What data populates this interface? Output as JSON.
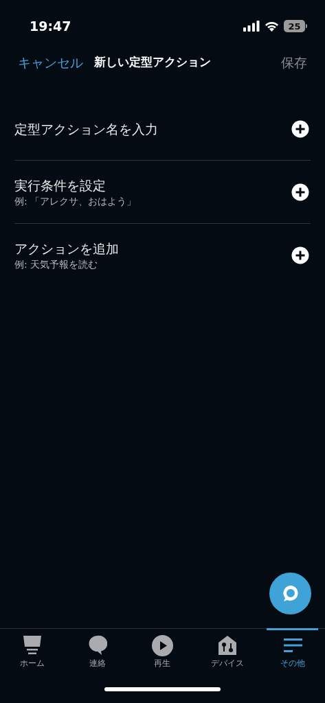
{
  "status_bar": {
    "time": "19:47",
    "battery": "25"
  },
  "nav": {
    "cancel": "キャンセル",
    "title": "新しい定型アクション",
    "save": {
      "label": "保存",
      "disabled": true
    }
  },
  "rows": [
    {
      "title": "定型アクション名を入力"
    },
    {
      "title": "実行条件を設定",
      "subtitle": "例: 「アレクサ、おはよう」"
    },
    {
      "title": "アクションを追加",
      "subtitle": "例: 天気予報を読む"
    }
  ],
  "tabs": [
    {
      "kind": "home",
      "label": "ホーム",
      "selected": false
    },
    {
      "kind": "chat",
      "label": "連絡",
      "selected": false
    },
    {
      "kind": "play",
      "label": "再生",
      "selected": false
    },
    {
      "kind": "devices",
      "label": "デバイス",
      "selected": false
    },
    {
      "kind": "more",
      "label": "その他",
      "selected": true
    }
  ]
}
